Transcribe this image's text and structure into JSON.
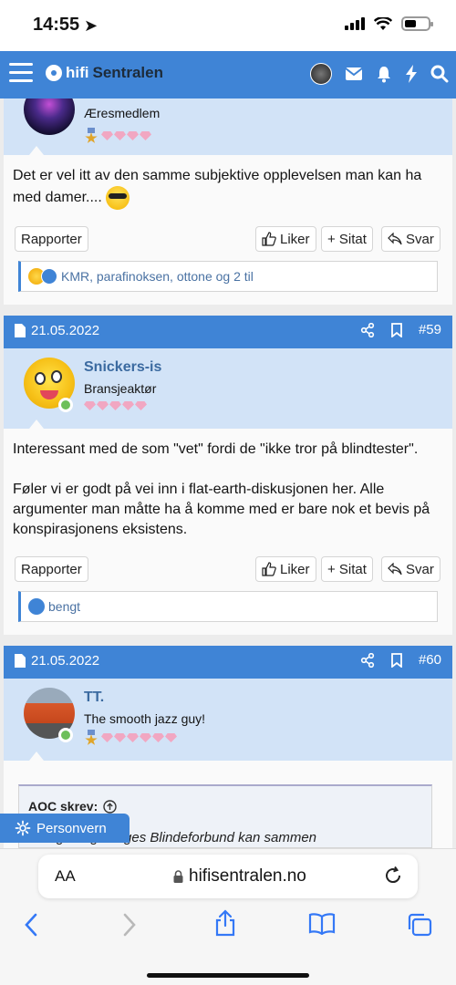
{
  "status": {
    "time": "14:55"
  },
  "appbar": {
    "logo_part1": "hifi",
    "logo_part2": "Sentralen"
  },
  "posts": [
    {
      "user_title": "Æresmedlem",
      "message": "Det er vel itt av den samme subjektive opplevelsen man kan ha med damer....",
      "report_label": "Rapporter",
      "like_label": "Liker",
      "quote_label": "+ Sitat",
      "reply_label": "Svar",
      "reactions_text": "KMR, parafinoksen, ottone og 2 til"
    },
    {
      "date": "21.05.2022",
      "number": "#59",
      "username": "Snickers-is",
      "user_title": "Bransjeaktør",
      "message_p1": "Interessant med de som \"vet\" fordi de \"ikke tror på blindtester\".",
      "message_p2": "Føler vi er godt på vei inn i flat-earth-diskusjonen her. Alle argumenter man måtte ha å komme med er bare nok et bevis på konspirasjonens eksistens.",
      "report_label": "Rapporter",
      "like_label": "Liker",
      "quote_label": "+ Sitat",
      "reply_label": "Svar",
      "reactions_text": "bengt"
    },
    {
      "date": "21.05.2022",
      "number": "#60",
      "username": "TT.",
      "user_title": "The smooth jazz guy!",
      "quote_author": "AOC skrev:",
      "quote_text": "i Bergen og Norges Blindeforbund kan sammen"
    }
  ],
  "cookie_button": "Personvern",
  "browser": {
    "aa": "AA",
    "url": "hifisentralen.no"
  },
  "colors": {
    "accent": "#3f84d6",
    "user_bg": "#d2e3f7",
    "online": "#6dbf5a"
  }
}
